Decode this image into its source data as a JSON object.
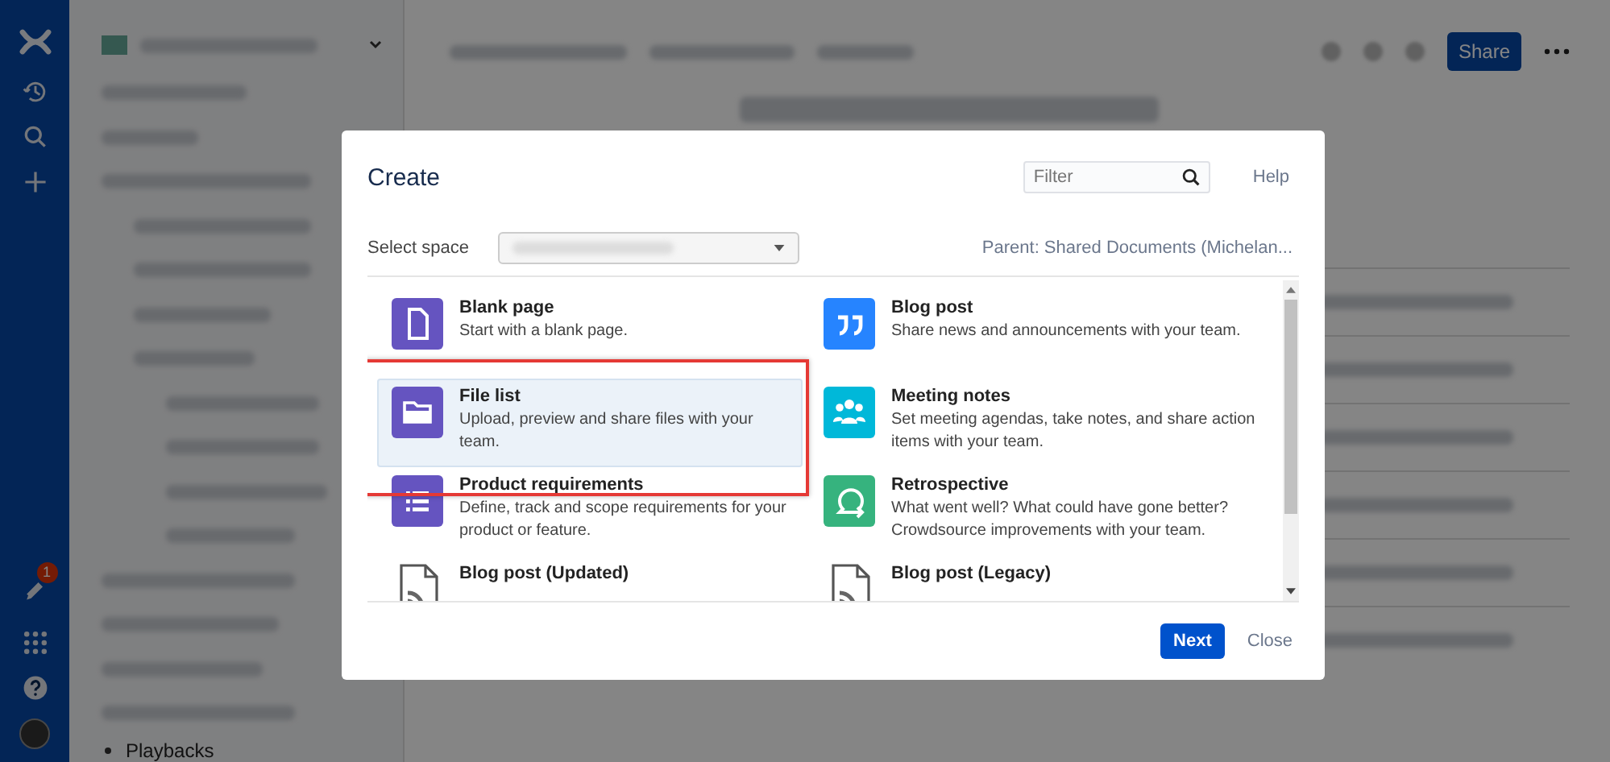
{
  "nav": {
    "notification_badge": "1"
  },
  "page": {
    "share_button": "Share",
    "sidebar_last_item": "Playbacks"
  },
  "dialog": {
    "title": "Create",
    "filter": {
      "placeholder": "Filter"
    },
    "help": "Help",
    "select_space_label": "Select space",
    "parent": "Parent: Shared Documents (Michelan...",
    "templates": [
      {
        "kind": "page",
        "color": "#6554c0",
        "name": "Blank page",
        "description": "Start with a blank page.",
        "selected": false,
        "annotated": false
      },
      {
        "kind": "quote",
        "color": "#2684ff",
        "name": "Blog post",
        "description": "Share news and announcements with your team.",
        "selected": false,
        "annotated": false
      },
      {
        "kind": "folder",
        "color": "#6554c0",
        "name": "File list",
        "description": "Upload, preview and share files with your team.",
        "selected": true,
        "annotated": true
      },
      {
        "kind": "people",
        "color": "#00b8d9",
        "name": "Meeting notes",
        "description": "Set meeting agendas, take notes, and share action items with your team.",
        "selected": false,
        "annotated": false
      },
      {
        "kind": "list",
        "color": "#6554c0",
        "name": "Product requirements",
        "description": "Define, track and scope requirements for your product or feature.",
        "selected": false,
        "annotated": false
      },
      {
        "kind": "loop",
        "color": "#36b37e",
        "name": "Retrospective",
        "description": "What went well? What could have gone better? Crowdsource improvements with your team.",
        "selected": false,
        "annotated": false
      },
      {
        "kind": "rss",
        "name": "Blog post (Updated)",
        "selected": false,
        "annotated": false
      },
      {
        "kind": "rss",
        "name": "Blog post (Legacy)",
        "selected": false,
        "annotated": false
      }
    ],
    "buttons": {
      "next": "Next",
      "close": "Close"
    }
  }
}
